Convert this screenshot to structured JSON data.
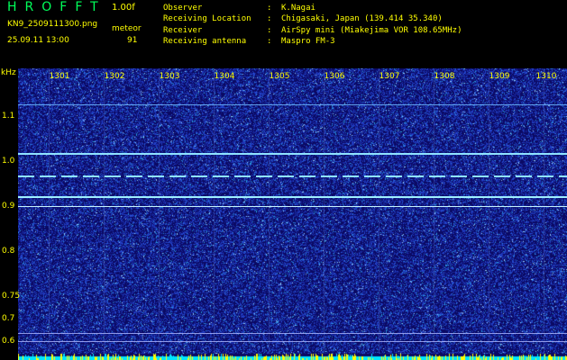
{
  "header": {
    "brand": "HROFFT",
    "version": "1.00f",
    "filename": "KN9_2509111300.png",
    "meteor_label": "meteor",
    "datetime": "25.09.11 13:00",
    "meteor_count": "91"
  },
  "info": [
    {
      "key": "Observer",
      "value": "K.Nagai"
    },
    {
      "key": "Receiving Location",
      "value": "Chigasaki, Japan (139.414 35.340)"
    },
    {
      "key": "Receiver",
      "value": "AirSpy mini (Miakejima VOR 108.65MHz)"
    },
    {
      "key": "Receiving antenna",
      "value": "Maspro FM-3"
    }
  ],
  "axis": {
    "y_unit": "kHz",
    "y_ticks": [
      "1.1",
      "1.0",
      "0.9",
      "0.8",
      "0.75",
      "0.7",
      "0.6"
    ],
    "x_ticks": [
      "1301",
      "1302",
      "1303",
      "1304",
      "1305",
      "1306",
      "1307",
      "1308",
      "1309",
      "1310"
    ]
  },
  "colors": {
    "background": "#0b0a64",
    "text": "#ffff00",
    "brand": "#00ff5a",
    "tone": "#8fe3ff",
    "meter_cyan": "#00e5ff",
    "meter_yellow": "#ffff00"
  }
}
